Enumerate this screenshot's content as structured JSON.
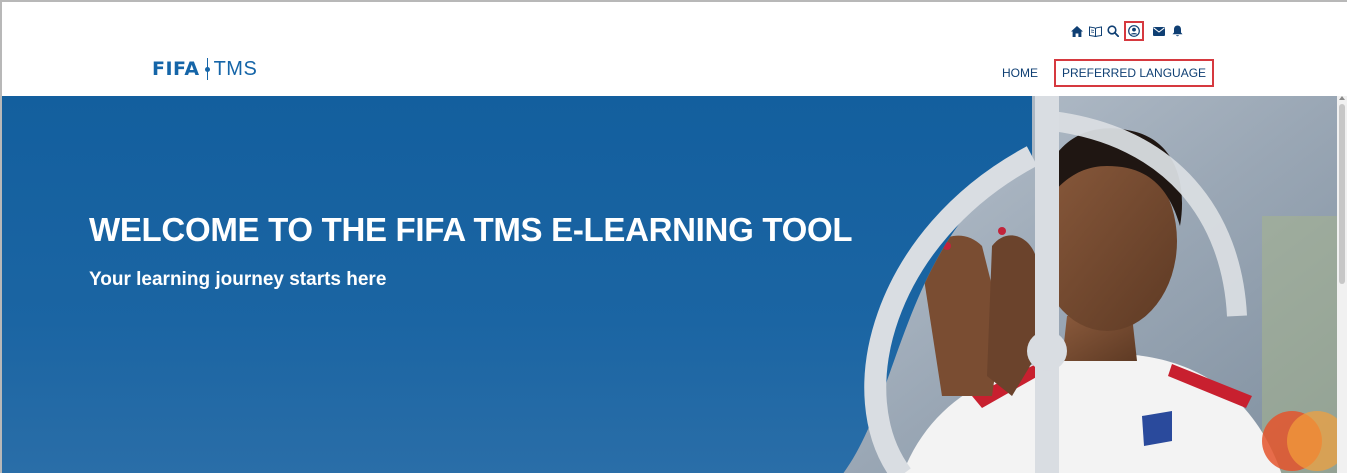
{
  "header": {
    "logo": {
      "brand": "FIFA",
      "product": "TMS"
    },
    "icons": [
      {
        "name": "home-icon",
        "label": "Home"
      },
      {
        "name": "book-icon",
        "label": "Manual"
      },
      {
        "name": "search-icon",
        "label": "Search"
      },
      {
        "name": "user-icon",
        "label": "Profile",
        "highlighted": true
      },
      {
        "name": "envelope-icon",
        "label": "Messages"
      },
      {
        "name": "bell-icon",
        "label": "Notifications"
      }
    ],
    "nav": {
      "home": "HOME",
      "preferred_language": "PREFERRED LANGUAGE"
    }
  },
  "hero": {
    "title": "WELCOME TO THE FIFA TMS E-LEARNING TOOL",
    "subtitle": "Your learning journey starts here"
  },
  "colors": {
    "brand_blue": "#1565a8",
    "hero_blue": "#135f9e",
    "nav_text": "#0f3f73",
    "highlight_red": "#d6393f"
  }
}
